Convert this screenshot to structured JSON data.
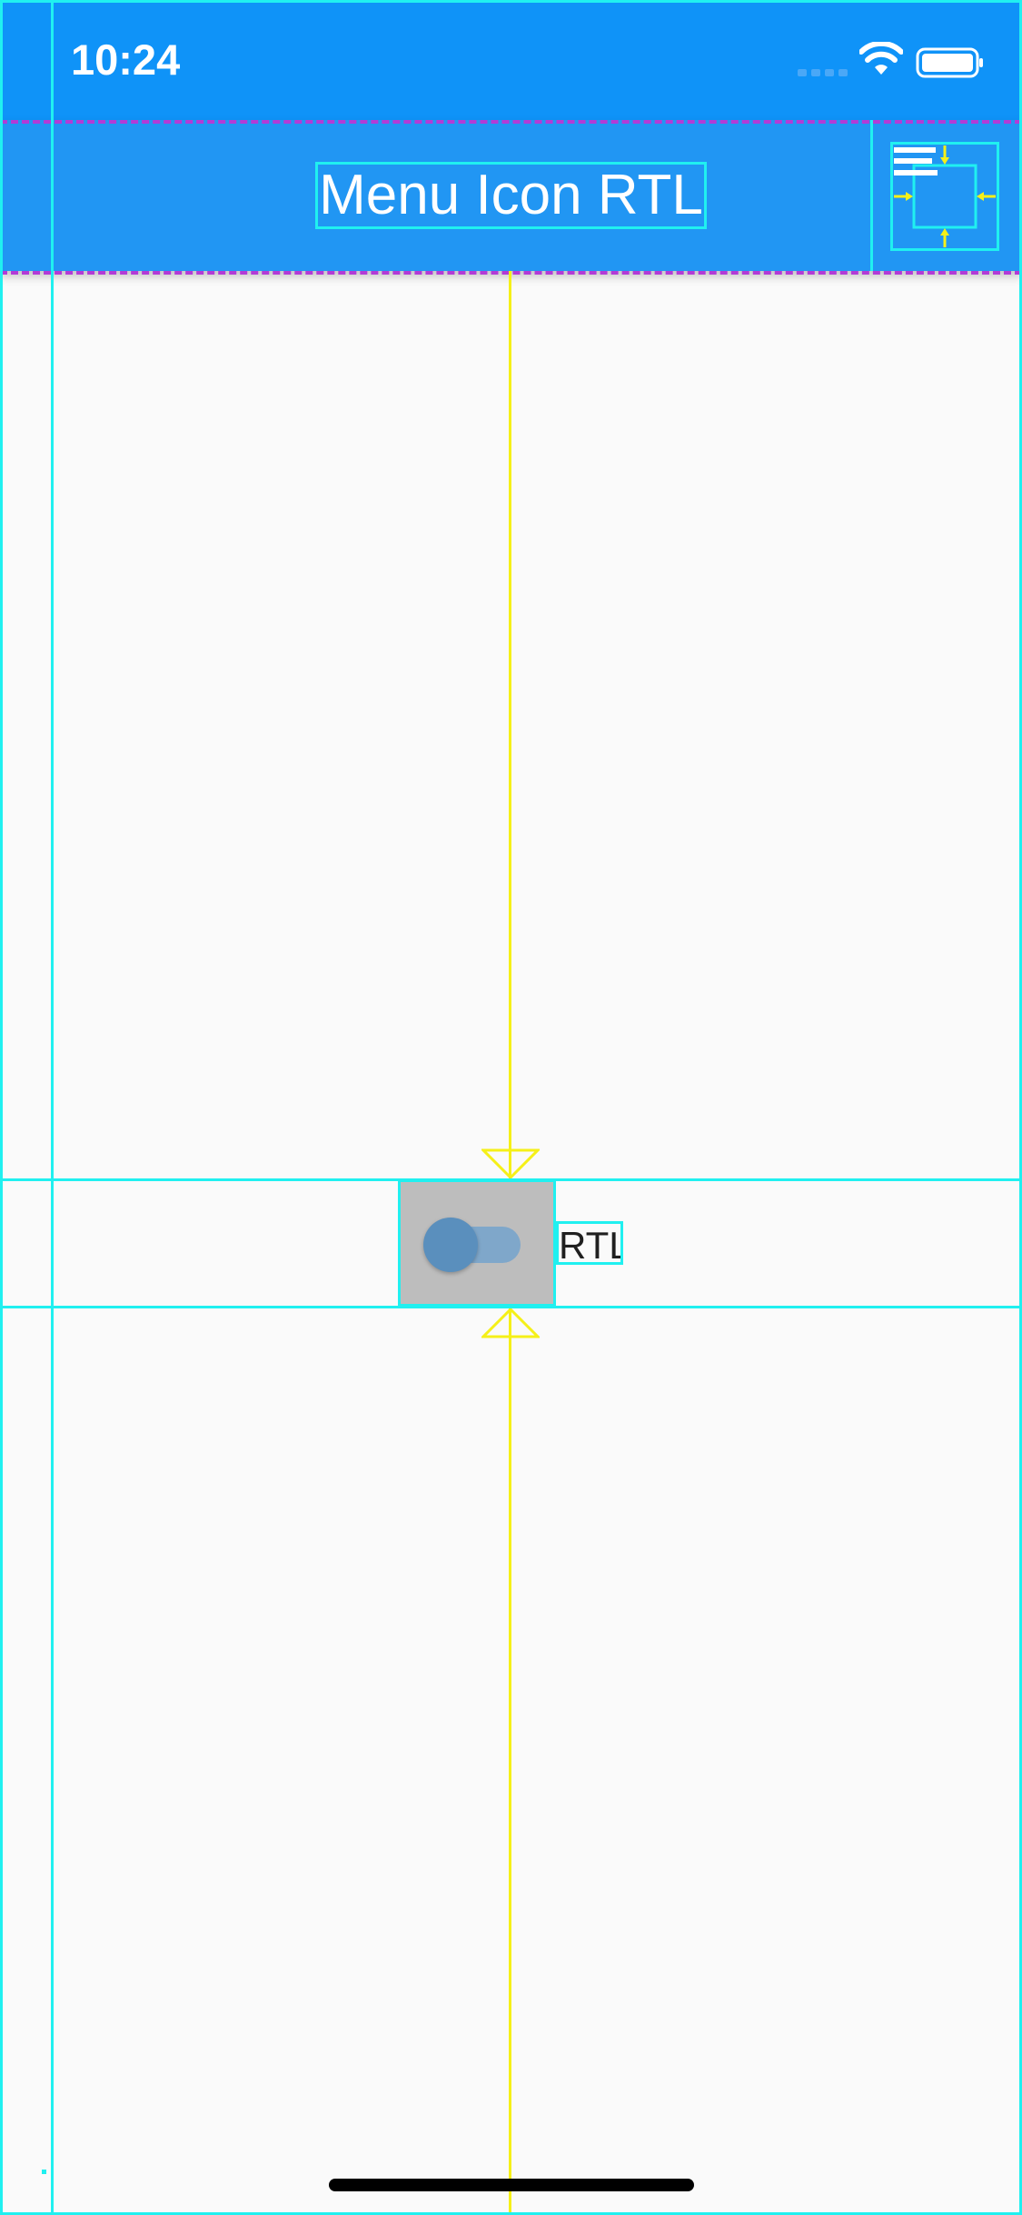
{
  "status_bar": {
    "time": "10:24",
    "icons": [
      "cellular-signal-icon",
      "wifi-icon",
      "battery-icon"
    ],
    "background_color": "#0f93f8"
  },
  "app_bar": {
    "title": "Menu Icon RTL",
    "action_icon": "menu-icon",
    "background_color": "#2196f3",
    "title_color": "#ffffff"
  },
  "content": {
    "rtl_switch": {
      "label": "RTL",
      "state": "off",
      "thumb_color": "#5a8fbd",
      "track_color": "#7fa7ca"
    }
  },
  "colors": {
    "debug_outline": "#20f0f0",
    "debug_center_line": "#f5f018",
    "debug_dash": "#b33bd6",
    "page_background": "#fafafa"
  }
}
